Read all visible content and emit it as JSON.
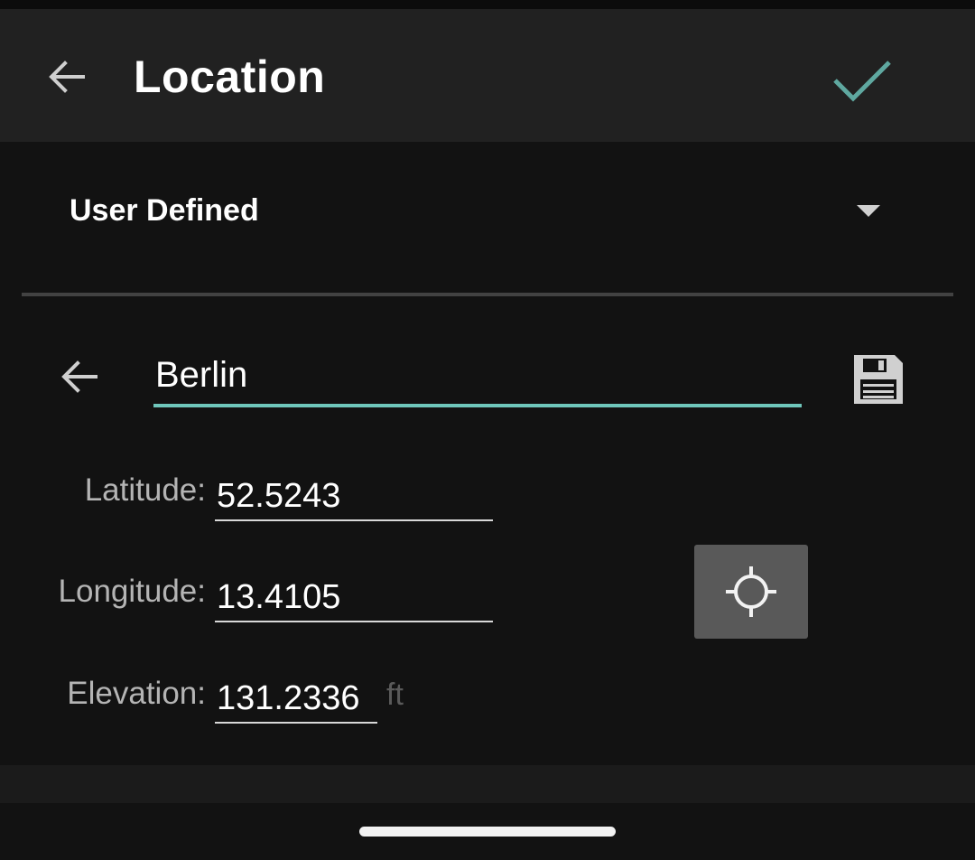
{
  "app_bar": {
    "title": "Location",
    "back_icon": "arrow-left-icon",
    "confirm_icon": "checkmark-icon",
    "confirm_color": "#5fa8a0"
  },
  "location_type": {
    "selected": "User Defined",
    "icon": "dropdown-caret-icon"
  },
  "name_row": {
    "back_icon": "arrow-left-icon",
    "value": "Berlin",
    "save_icon": "floppy-disk-icon",
    "accent_color": "#6fc6bb"
  },
  "fields": {
    "latitude": {
      "label": "Latitude:",
      "value": "52.5243"
    },
    "longitude": {
      "label": "Longitude:",
      "value": "13.4105"
    },
    "elevation": {
      "label": "Elevation:",
      "value": "131.2336",
      "unit": "ft"
    }
  },
  "gps_button": {
    "icon": "crosshair-icon"
  }
}
